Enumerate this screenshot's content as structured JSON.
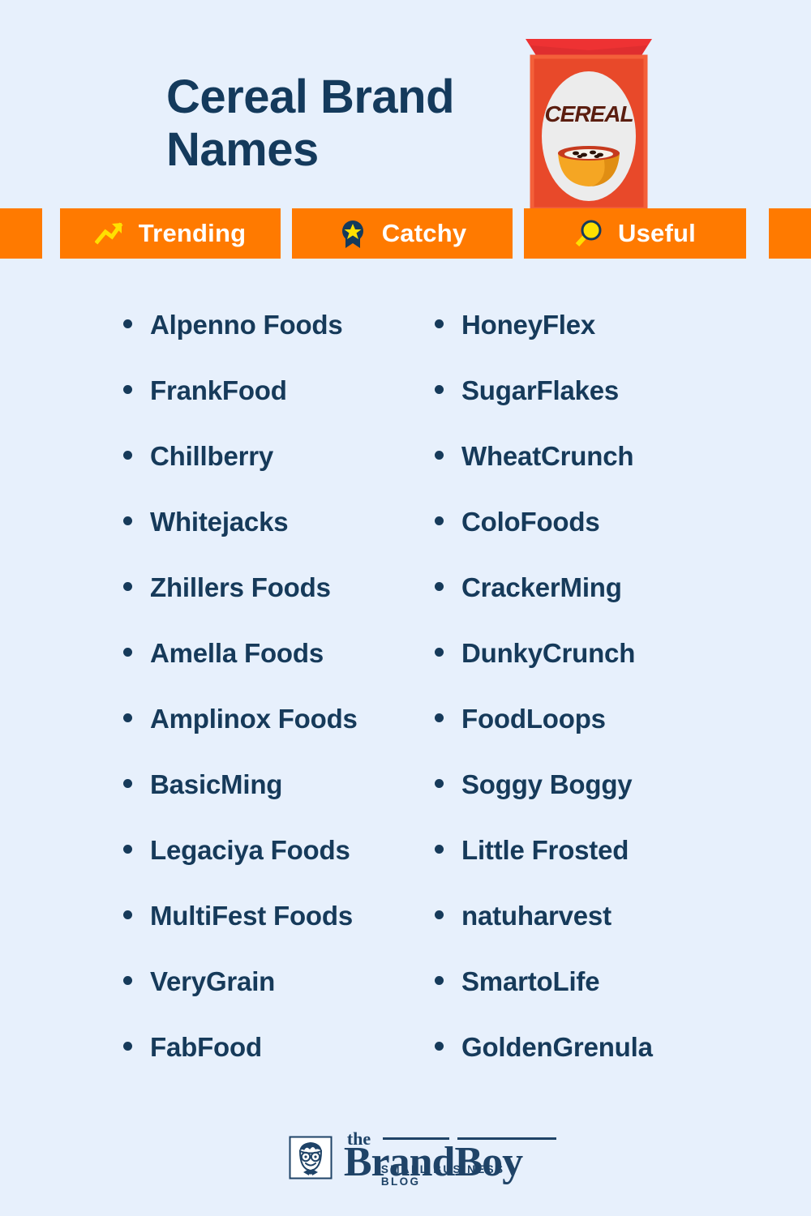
{
  "header": {
    "title": "Cereal Brand Names",
    "illustration": {
      "name": "cereal-box",
      "box_label": "CEREAL",
      "colors": {
        "box_body": "#E8492A",
        "box_lid": "#EE3233",
        "box_lid_shade": "#D42B2B",
        "oval": "#ECECEC",
        "bowl": "#F5A623",
        "bowl_milk": "#F2F2F2",
        "label_text": "#5B1E10"
      }
    }
  },
  "badge_bar": {
    "accent_color": "#FF7A00",
    "label_color": "#FFFFFF",
    "badges": [
      {
        "label": "Trending",
        "icon": "trending-up-icon",
        "icon_color": "#FFE000"
      },
      {
        "label": "Catchy",
        "icon": "award-medal-icon",
        "icon_color": "#FFE000"
      },
      {
        "label": "Useful",
        "icon": "magnifying-glass-icon",
        "icon_color": "#FFE000"
      }
    ]
  },
  "names": {
    "text_color": "#163A5A",
    "left_column": [
      "Alpenno Foods",
      "FrankFood",
      "Chillberry",
      "Whitejacks",
      "Zhillers Foods",
      "Amella Foods",
      "Amplinox Foods",
      "BasicMing",
      "Legaciya Foods",
      "MultiFest Foods",
      "VeryGrain",
      "FabFood"
    ],
    "right_column": [
      "HoneyFlex",
      "SugarFlakes",
      "WheatCrunch",
      "ColoFoods",
      "CrackerMing",
      "DunkyCrunch",
      "FoodLoops",
      "Soggy Boggy",
      "Little Frosted",
      "natuharvest",
      "SmartoLife",
      "GoldenGrenula"
    ]
  },
  "footer": {
    "logo_the": "the",
    "logo_name": "BrandBoy",
    "logo_tagline": "SMALL BUSINESS BLOG",
    "logo_icon": "boy-face-icon",
    "logo_color": "#1F4367"
  },
  "background_color": "#E7F0FC"
}
